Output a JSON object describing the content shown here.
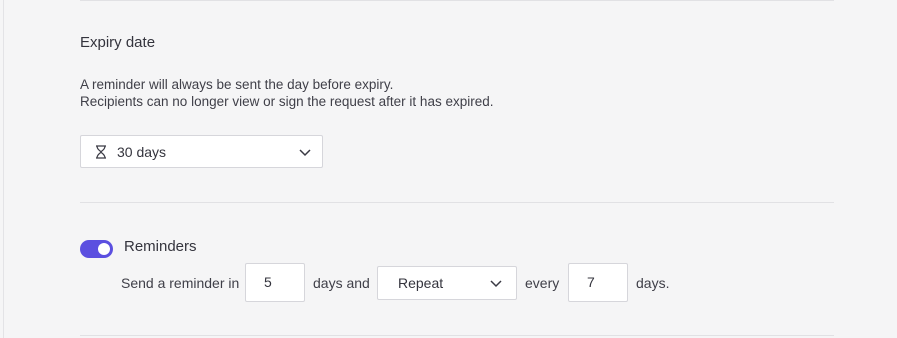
{
  "expiry": {
    "title": "Expiry date",
    "desc_line1": "A reminder will always be sent the day before expiry.",
    "desc_line2": "Recipients can no longer view or sign the request after it has expired.",
    "selected": "30 days",
    "icon": "hourglass-icon"
  },
  "reminders": {
    "enabled": true,
    "title": "Reminders",
    "prefix": "Send a reminder in",
    "days_value": "5",
    "days_and": "days and",
    "repeat_selected": "Repeat",
    "every": "every",
    "every_value": "7",
    "suffix": "days."
  },
  "colors": {
    "accent": "#5b4fe0",
    "background": "#f5f5f6",
    "border": "#d6d6db"
  }
}
